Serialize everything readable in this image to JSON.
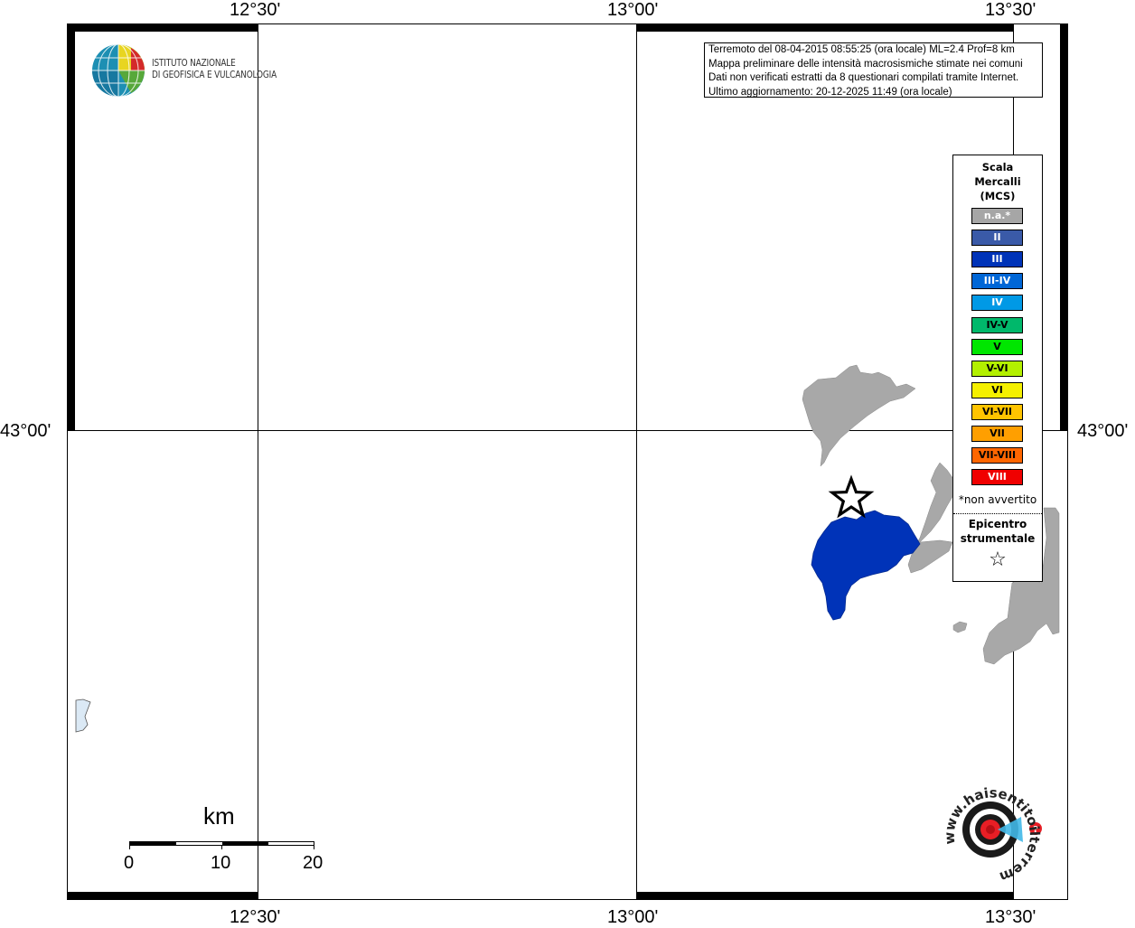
{
  "map": {
    "axis_top": [
      "12°30'",
      "13°00'",
      "13°30'"
    ],
    "axis_bottom": [
      "12°30'",
      "13°00'",
      "13°30'"
    ],
    "axis_left": "43°00'",
    "axis_right": "43°00'"
  },
  "institute": {
    "line1": "ISTITUTO NAZIONALE",
    "line2": "DI GEOFISICA E VULCANOLOGIA"
  },
  "info": {
    "line1": "Terremoto del 08-04-2015 08:55:25 (ora locale) ML=2.4 Prof=8 km",
    "line2": "Mappa preliminare delle intensità macrosismiche stimate nei comuni",
    "line3": "Dati non verificati estratti da 8 questionari compilati tramite Internet.",
    "line4": "Ultimo aggiornamento: 20-12-2025 11:49 (ora locale)"
  },
  "legend": {
    "title1": "Scala",
    "title2": "Mercalli",
    "title3": "(MCS)",
    "items": [
      {
        "label": "n.a.*",
        "color": "#a6a6a6",
        "text_color": "#ffffff"
      },
      {
        "label": "II",
        "color": "#3a5aa8",
        "text_color": "#ffffff"
      },
      {
        "label": "III",
        "color": "#0033b8",
        "text_color": "#ffffff"
      },
      {
        "label": "III-IV",
        "color": "#0066d6",
        "text_color": "#ffffff"
      },
      {
        "label": "IV",
        "color": "#0099e6",
        "text_color": "#ffffff"
      },
      {
        "label": "IV-V",
        "color": "#00b86b",
        "text_color": "#000000"
      },
      {
        "label": "V",
        "color": "#00e600",
        "text_color": "#000000"
      },
      {
        "label": "V-VI",
        "color": "#b3f000",
        "text_color": "#000000"
      },
      {
        "label": "VI",
        "color": "#f5f000",
        "text_color": "#000000"
      },
      {
        "label": "VI-VII",
        "color": "#ffc400",
        "text_color": "#000000"
      },
      {
        "label": "VII",
        "color": "#ff9f00",
        "text_color": "#000000"
      },
      {
        "label": "VII-VIII",
        "color": "#ff6600",
        "text_color": "#000000"
      },
      {
        "label": "VIII",
        "color": "#f00000",
        "text_color": "#ffffff"
      }
    ],
    "note": "*non avvertito",
    "epicenter1": "Epicentro",
    "epicenter2": "strumentale",
    "epicenter_symbol": "☆"
  },
  "scalebar": {
    "unit": "km",
    "ticks": [
      "0",
      "10",
      "20"
    ]
  },
  "site_logo": {
    "text": "www.haisentitoilterremoto.it"
  },
  "colors": {
    "land": "#a8a8a8",
    "intensity_iii": "#0033b8",
    "water": "#dbe9f5"
  }
}
